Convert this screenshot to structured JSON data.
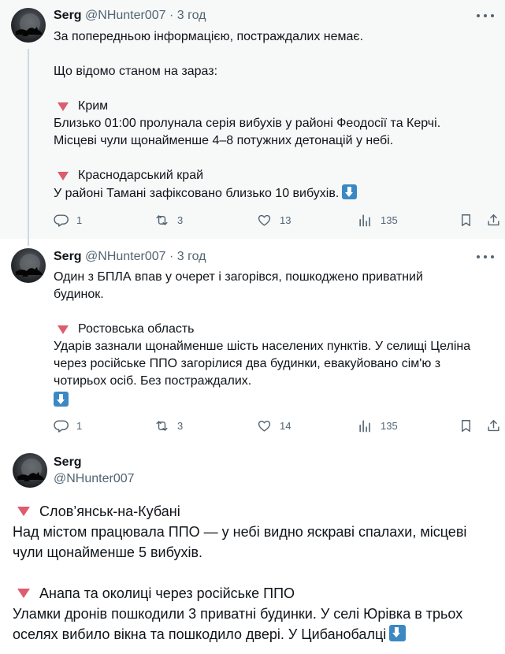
{
  "tweets": [
    {
      "name": "Serg",
      "handle": "@NHunter007",
      "dot": "·",
      "time": "3 год",
      "lines": [
        "За попередньою інформацією, постраждалих немає.",
        "Що відомо станом на зараз:"
      ],
      "sections": [
        {
          "title": "Крим",
          "text": "Близько 01:00 пролунала серія вибухів у районі Феодосії та Керчі.\nМісцеві чули щонайменше 4–8 потужних детонацій у небі."
        },
        {
          "title": "Краснодарський край",
          "text": "У районі Тамані зафіксовано близько 10 вибухів."
        }
      ],
      "stats": {
        "replies": "1",
        "reposts": "3",
        "likes": "13",
        "views": "135"
      }
    },
    {
      "name": "Serg",
      "handle": "@NHunter007",
      "dot": "·",
      "time": "3 год",
      "intro": "Один з БПЛА впав у очерет і загорівся, пошкоджено приватний\nбудинок.",
      "sections": [
        {
          "title": "Ростовська область",
          "text": "Ударів зазнали щонайменше шість населених пунктів. У селищі Целіна\nчерез російське ППО загорілися два будинки, евакуйовано сім'ю з\nчотирьох осіб. Без постраждалих."
        }
      ],
      "stats": {
        "replies": "1",
        "reposts": "3",
        "likes": "14",
        "views": "135"
      }
    },
    {
      "name": "Serg",
      "handle": "@NHunter007",
      "sections": [
        {
          "title": "Слов’янськ-на-Кубані",
          "text": "Над містом працювала ППО — у небі видно яскраві спалахи, місцеві\nчули щонайменше 5 вибухів."
        },
        {
          "title": "Анапа та околиці через російське ППО",
          "text": "Уламки дронів пошкодили 3 приватні будинки. У селі Юрівка в трьох\nоселях вибило вікна та пошкодило двері. У Цибанобалці"
        }
      ]
    }
  ],
  "icons": {
    "section_marker": "red-down-triangle",
    "down_arrow": "blue-down-arrow-emoji",
    "reply": "reply-icon",
    "repost": "repost-icon",
    "like": "like-icon",
    "views": "views-icon",
    "bookmark": "bookmark-icon",
    "share": "share-icon"
  },
  "colors": {
    "text": "#0f1419",
    "muted": "#536471",
    "marker": "#dd5c6e",
    "arrow_emoji": "#3b88c3",
    "thread_line": "#cfd9de",
    "highlight_bg": "#f7f9f9"
  }
}
